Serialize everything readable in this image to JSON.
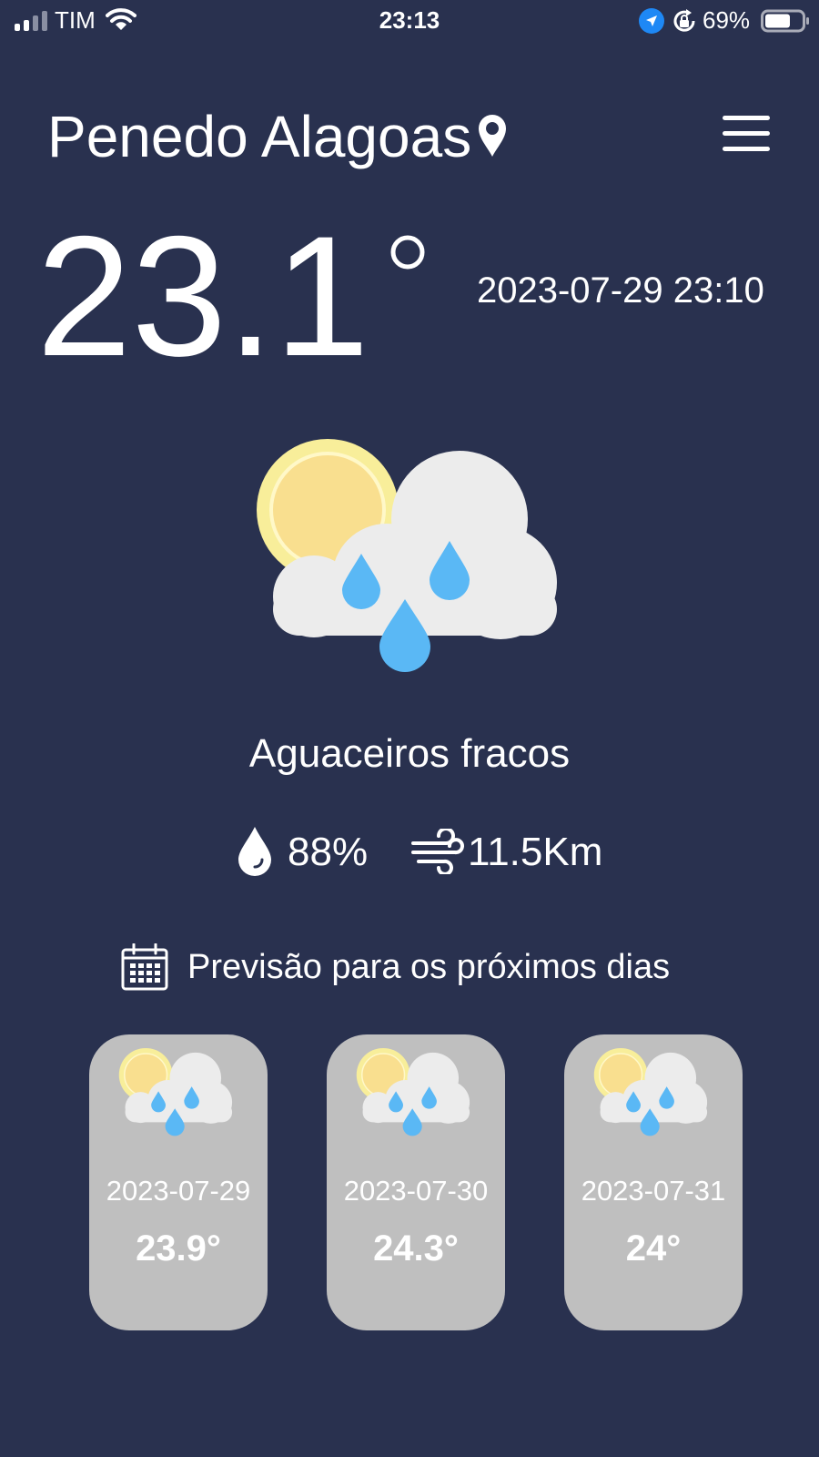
{
  "status_bar": {
    "carrier": "TIM",
    "time": "23:13",
    "battery": "69%"
  },
  "header": {
    "city": "Penedo Alagoas",
    "icons": [
      "map-pin-icon",
      "hamburger-menu-icon"
    ]
  },
  "current": {
    "temperature": "23.1",
    "datetime": "2023-07-29 23:10",
    "condition": "Aguaceiros fracos",
    "icon": "sun-cloud-rain-icon",
    "humidity": "88%",
    "wind": "11.5Km"
  },
  "forecast": {
    "title": "Previsão para os próximos dias",
    "days": [
      {
        "date": "2023-07-29",
        "temp": "23.9°"
      },
      {
        "date": "2023-07-30",
        "temp": "24.3°"
      },
      {
        "date": "2023-07-31",
        "temp": "24°"
      }
    ]
  },
  "colors": {
    "background": "#29314f",
    "card": "#bfbfbf",
    "sun": "#f9df8f",
    "cloud": "#ececec",
    "rain": "#5ab8f5"
  }
}
